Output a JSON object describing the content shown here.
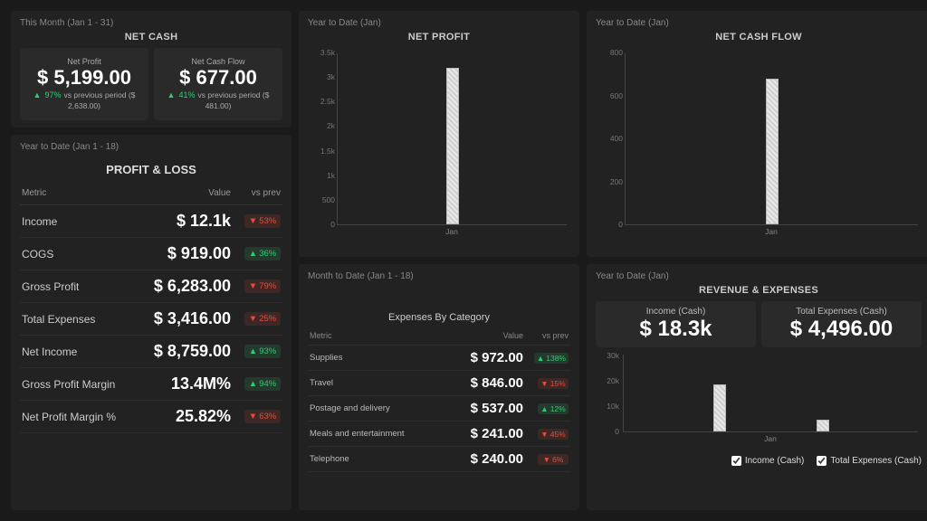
{
  "netcash": {
    "period": "This Month (Jan 1 - 31)",
    "title": "NET CASH",
    "cards": [
      {
        "label": "Net Profit",
        "value": "$ 5,199.00",
        "delta": "97%",
        "dir": "up",
        "sub": "vs previous period ($ 2,638.00)"
      },
      {
        "label": "Net Cash Flow",
        "value": "$ 677.00",
        "delta": "41%",
        "dir": "up",
        "sub": "vs previous period ($ 481.00)"
      }
    ]
  },
  "pl": {
    "period": "Year to Date (Jan 1 - 18)",
    "title": "PROFIT & LOSS",
    "headers": {
      "metric": "Metric",
      "value": "Value",
      "delta": "vs prev"
    },
    "rows": [
      {
        "metric": "Income",
        "value": "$ 12.1k",
        "delta": "53%",
        "dir": "down"
      },
      {
        "metric": "COGS",
        "value": "$ 919.00",
        "delta": "36%",
        "dir": "up"
      },
      {
        "metric": "Gross Profit",
        "value": "$ 6,283.00",
        "delta": "79%",
        "dir": "down"
      },
      {
        "metric": "Total Expenses",
        "value": "$ 3,416.00",
        "delta": "25%",
        "dir": "down"
      },
      {
        "metric": "Net Income",
        "value": "$ 8,759.00",
        "delta": "93%",
        "dir": "up"
      },
      {
        "metric": "Gross Profit Margin",
        "value": "13.4M%",
        "delta": "94%",
        "dir": "up"
      },
      {
        "metric": "Net Profit Margin %",
        "value": "25.82%",
        "delta": "63%",
        "dir": "down"
      }
    ]
  },
  "netprofit_chart": {
    "period": "Year to Date (Jan)",
    "title": "NET PROFIT"
  },
  "netcashflow_chart": {
    "period": "Year to Date (Jan)",
    "title": "NET CASH FLOW"
  },
  "expenses": {
    "period": "Month to Date (Jan 1 - 18)",
    "title": "Expenses By Category",
    "headers": {
      "metric": "Metric",
      "value": "Value",
      "delta": "vs prev"
    },
    "rows": [
      {
        "metric": "Supplies",
        "value": "$ 972.00",
        "delta": "138%",
        "dir": "up"
      },
      {
        "metric": "Travel",
        "value": "$ 846.00",
        "delta": "15%",
        "dir": "down"
      },
      {
        "metric": "Postage and delivery",
        "value": "$ 537.00",
        "delta": "12%",
        "dir": "up"
      },
      {
        "metric": "Meals and entertainment",
        "value": "$ 241.00",
        "delta": "45%",
        "dir": "down"
      },
      {
        "metric": "Telephone",
        "value": "$ 240.00",
        "delta": "6%",
        "dir": "down"
      }
    ]
  },
  "revexp": {
    "period": "Year to Date (Jan)",
    "title": "REVENUE & EXPENSES",
    "cards": [
      {
        "label": "Income (Cash)",
        "value": "$ 18.3k"
      },
      {
        "label": "Total Expenses (Cash)",
        "value": "$ 4,496.00"
      }
    ],
    "legend": [
      "Income (Cash)",
      "Total Expenses (Cash)"
    ]
  },
  "chart_data": [
    {
      "type": "bar",
      "title": "NET PROFIT",
      "categories": [
        "Jan"
      ],
      "values": [
        3200
      ],
      "ylabel": "",
      "ylim": [
        0,
        3500
      ],
      "yticks": [
        "3.5k",
        "3k",
        "2.5k",
        "2k",
        "1.5k",
        "1k",
        "500",
        "0"
      ]
    },
    {
      "type": "bar",
      "title": "NET CASH FLOW",
      "categories": [
        "Jan"
      ],
      "values": [
        680
      ],
      "ylabel": "",
      "ylim": [
        0,
        800
      ],
      "yticks": [
        "800",
        "600",
        "400",
        "200",
        "0"
      ]
    },
    {
      "type": "bar",
      "title": "REVENUE & EXPENSES",
      "categories": [
        "Jan"
      ],
      "series": [
        {
          "name": "Income (Cash)",
          "values": [
            18300
          ]
        },
        {
          "name": "Total Expenses (Cash)",
          "values": [
            4496
          ]
        }
      ],
      "ylabel": "",
      "ylim": [
        0,
        30000
      ],
      "yticks": [
        "30k",
        "20k",
        "10k",
        "0"
      ]
    }
  ]
}
